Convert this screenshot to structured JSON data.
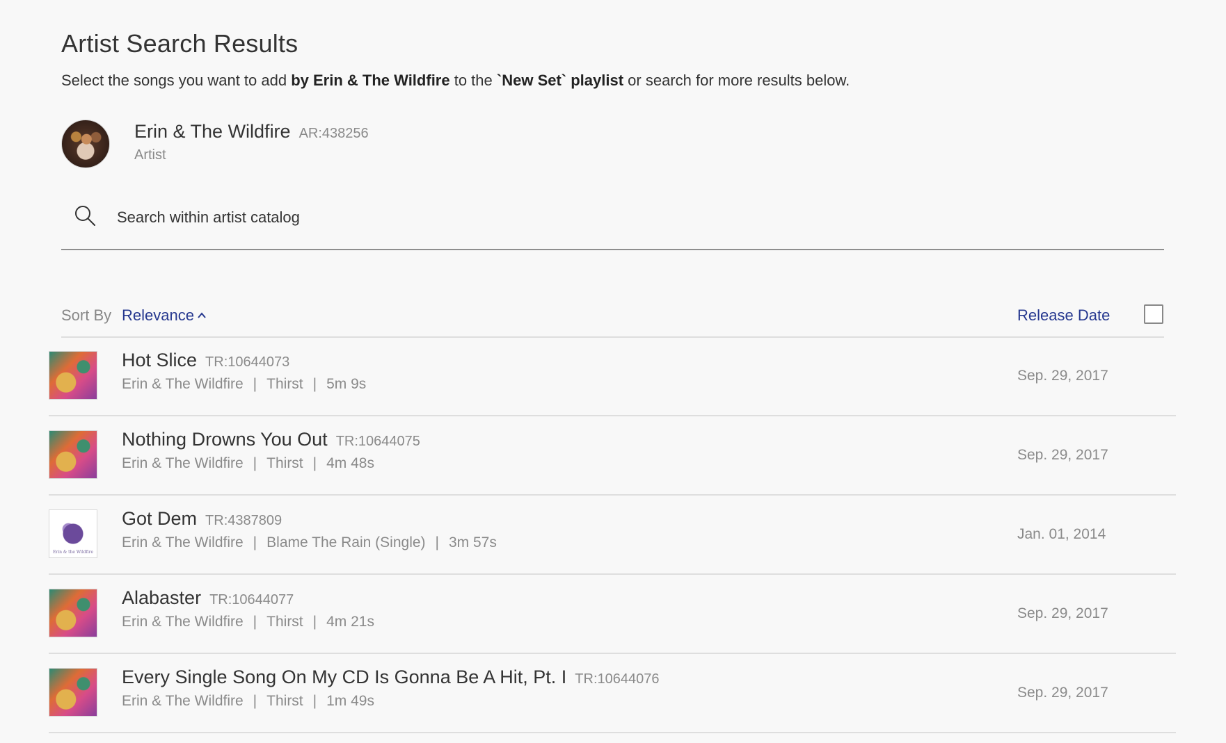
{
  "header": {
    "title": "Artist Search Results",
    "subtitle_pre": "Select the songs you want to add ",
    "subtitle_artist": "by Erin & The Wildfire",
    "subtitle_mid": " to the ",
    "subtitle_playlist": "`New Set` playlist",
    "subtitle_post": " or search for more results below."
  },
  "artist": {
    "name": "Erin & The Wildfire",
    "code": "AR:438256",
    "type": "Artist"
  },
  "search": {
    "placeholder": "Search within artist catalog",
    "value": ""
  },
  "sort": {
    "label": "Sort By",
    "value": "Relevance",
    "direction": "ascending",
    "date_header": "Release Date",
    "select_all_checked": false
  },
  "tracks": [
    {
      "title": "Hot Slice",
      "code": "TR:10644073",
      "artist": "Erin & The Wildfire",
      "album": "Thirst",
      "duration": "5m 9s",
      "date": "Sep. 29, 2017"
    },
    {
      "title": "Nothing Drowns You Out",
      "code": "TR:10644075",
      "artist": "Erin & The Wildfire",
      "album": "Thirst",
      "duration": "4m 48s",
      "date": "Sep. 29, 2017"
    },
    {
      "title": "Got Dem",
      "code": "TR:4387809",
      "artist": "Erin & The Wildfire",
      "album": "Blame The Rain (Single)",
      "duration": "3m 57s",
      "date": "Jan. 01, 2014",
      "art_text": "Erin & the Wildfire"
    },
    {
      "title": "Alabaster",
      "code": "TR:10644077",
      "artist": "Erin & The Wildfire",
      "album": "Thirst",
      "duration": "4m 21s",
      "date": "Sep. 29, 2017"
    },
    {
      "title": "Every Single Song On My CD Is Gonna Be A Hit, Pt. I",
      "code": "TR:10644076",
      "artist": "Erin & The Wildfire",
      "album": "Thirst",
      "duration": "1m 49s",
      "date": "Sep. 29, 2017"
    }
  ],
  "separator": "|",
  "icons": {
    "search": "search-icon",
    "sort_chevron": "chevron-up-icon",
    "checkbox": "checkbox-icon"
  },
  "colors": {
    "accent": "#26388f",
    "background": "#f8f8f8",
    "muted_text": "#8a8a8a"
  }
}
